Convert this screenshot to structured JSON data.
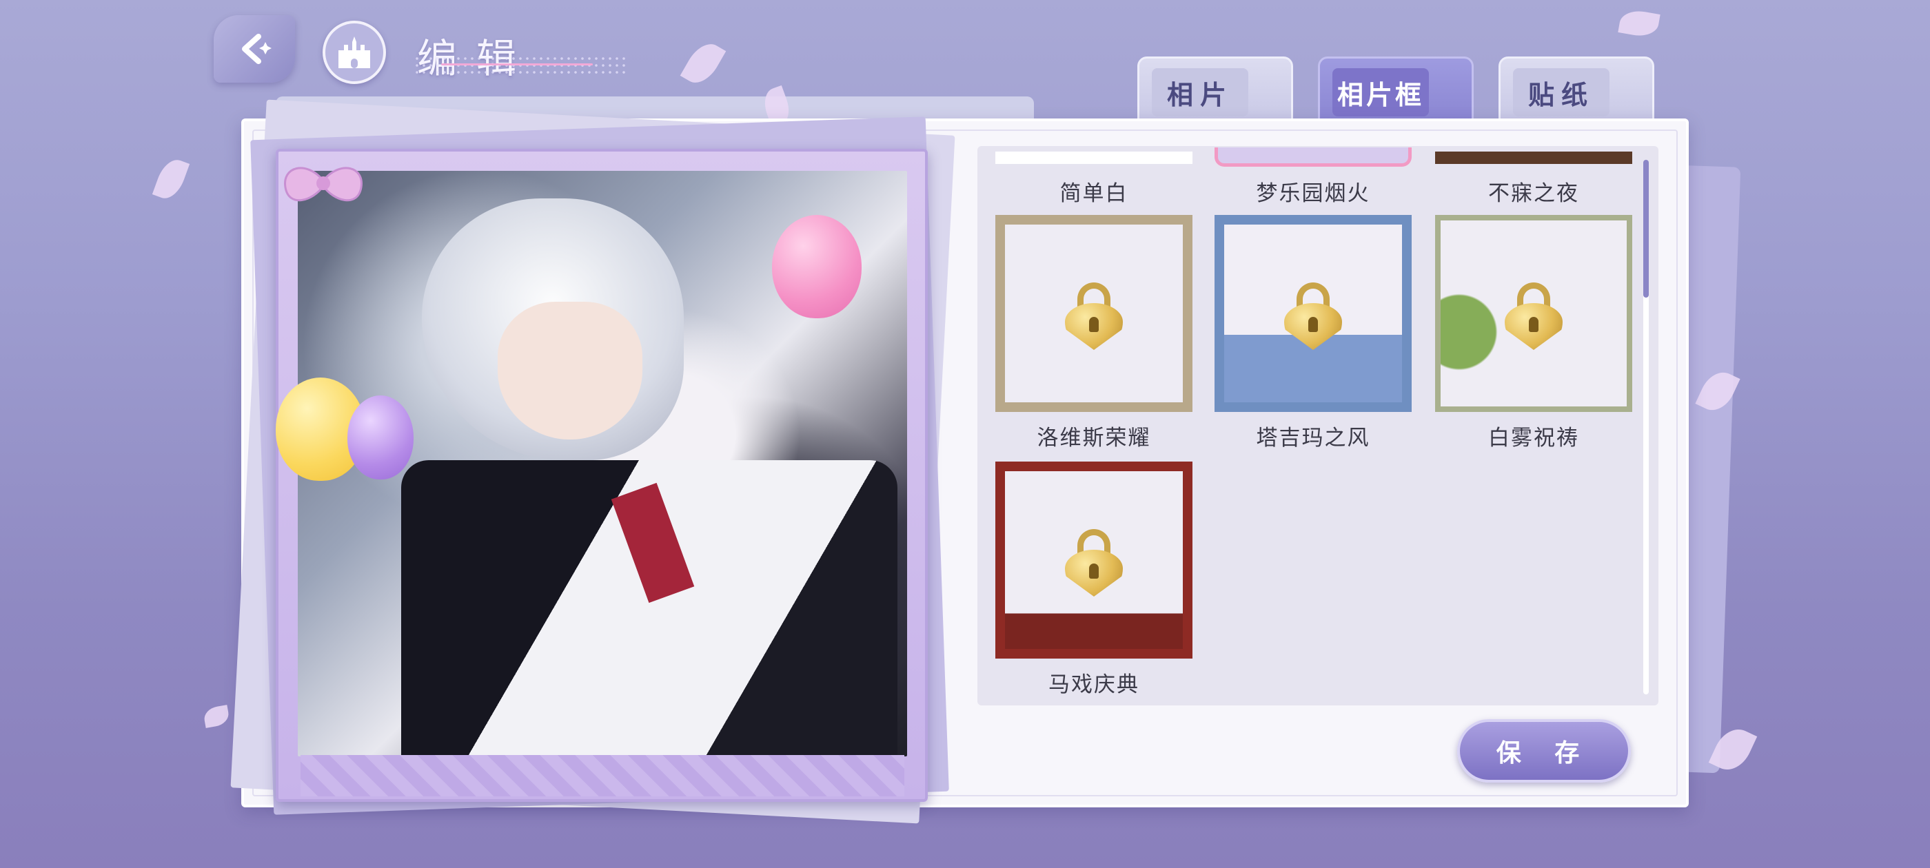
{
  "header": {
    "title": "编辑",
    "back_icon": "back-arrow-icon",
    "home_icon": "castle-home-icon"
  },
  "tabs": [
    {
      "label": "相片",
      "active": false
    },
    {
      "label": "相片框",
      "active": true
    },
    {
      "label": "贴纸",
      "active": false
    }
  ],
  "frames": {
    "partial_row": [
      {
        "label": "简单白",
        "locked": false,
        "selected": false
      },
      {
        "label": "梦乐园烟火",
        "locked": false,
        "selected": true
      },
      {
        "label": "不寐之夜",
        "locked": false,
        "selected": false
      }
    ],
    "items": [
      {
        "label": "洛维斯荣耀",
        "locked": true
      },
      {
        "label": "塔吉玛之风",
        "locked": true
      },
      {
        "label": "白雾祝祷",
        "locked": true
      },
      {
        "label": "马戏庆典",
        "locked": true
      }
    ]
  },
  "actions": {
    "save_label": "保 存"
  },
  "colors": {
    "accent": "#8a85d2",
    "selected_border": "#f29ac4",
    "lock_gold": "#e3bb55"
  }
}
